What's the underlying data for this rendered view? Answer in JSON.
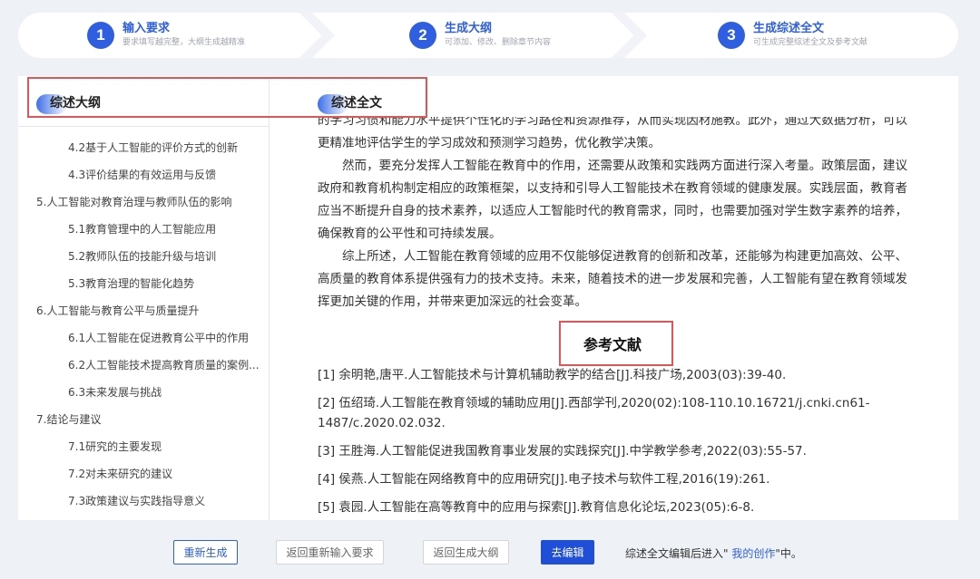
{
  "steps": [
    {
      "num": "1",
      "title": "输入要求",
      "sub": "要求填写越完整，大纲生成越精准"
    },
    {
      "num": "2",
      "title": "生成大纲",
      "sub": "可添加、修改、删除章节内容"
    },
    {
      "num": "3",
      "title": "生成综述全文",
      "sub": "可生成完整综述全文及参考文献"
    }
  ],
  "outline_pane": {
    "title": "综述大纲",
    "items": [
      {
        "level": 2,
        "text": "4.2基于人工智能的评价方式的创新"
      },
      {
        "level": 2,
        "text": "4.3评价结果的有效运用与反馈"
      },
      {
        "level": 1,
        "text": "5.人工智能对教育治理与教师队伍的影响"
      },
      {
        "level": 2,
        "text": "5.1教育管理中的人工智能应用"
      },
      {
        "level": 2,
        "text": "5.2教师队伍的技能升级与培训"
      },
      {
        "level": 2,
        "text": "5.3教育治理的智能化趋势"
      },
      {
        "level": 1,
        "text": "6.人工智能与教育公平与质量提升"
      },
      {
        "level": 2,
        "text": "6.1人工智能在促进教育公平中的作用"
      },
      {
        "level": 2,
        "text": "6.2人工智能技术提高教育质量的案例..."
      },
      {
        "level": 2,
        "text": "6.3未来发展与挑战"
      },
      {
        "level": 1,
        "text": "7.结论与建议"
      },
      {
        "level": 2,
        "text": "7.1研究的主要发现"
      },
      {
        "level": 2,
        "text": "7.2对未来研究的建议"
      },
      {
        "level": 2,
        "text": "7.3政策建议与实践指导意义"
      }
    ]
  },
  "fulltext_pane": {
    "title": "综述全文",
    "paragraphs": [
      "的学习习惯和能力水平提供个性化的学习路径和资源推荐，从而实现因材施教。此外，通过大数据分析，可以更精准地评估学生的学习成效和预测学习趋势，优化教学决策。",
      "然而，要充分发挥人工智能在教育中的作用，还需要从政策和实践两方面进行深入考量。政策层面，建议政府和教育机构制定相应的政策框架，以支持和引导人工智能技术在教育领域的健康发展。实践层面，教育者应当不断提升自身的技术素养，以适应人工智能时代的教育需求，同时，也需要加强对学生数字素养的培养，确保教育的公平性和可持续发展。",
      "综上所述，人工智能在教育领域的应用不仅能够促进教育的创新和改革，还能够为构建更加高效、公平、高质量的教育体系提供强有力的技术支持。未来，随着技术的进一步发展和完善，人工智能有望在教育领域发挥更加关键的作用，并带来更加深远的社会变革。"
    ],
    "references_title": "参考文献",
    "references": [
      "[1] 余明艳,唐平.人工智能技术与计算机辅助教学的结合[J].科技广场,2003(03):39-40.",
      "[2] 伍绍琦.人工智能在教育领域的辅助应用[J].西部学刊,2020(02):108-110.10.16721/j.cnki.cn61-1487/c.2020.02.032.",
      "[3] 王胜海.人工智能促进我国教育事业发展的实践探究[J].中学教学参考,2022(03):55-57.",
      "[4] 侯燕.人工智能在网络教育中的应用研究[J].电子技术与软件工程,2016(19):261.",
      "[5] 袁园.人工智能在高等教育中的应用与探索[J].教育信息化论坛,2023(05):6-8."
    ]
  },
  "footer": {
    "regenerate": "重新生成",
    "back_requirements": "返回重新输入要求",
    "back_outline": "返回生成大纲",
    "edit": "去编辑",
    "note_prefix": "综述全文编辑后进入\"",
    "note_link": " 我的创作",
    "note_suffix": "\"中。"
  },
  "colors": {
    "accent": "#2f5fe0",
    "highlight_box": "#e05555"
  }
}
